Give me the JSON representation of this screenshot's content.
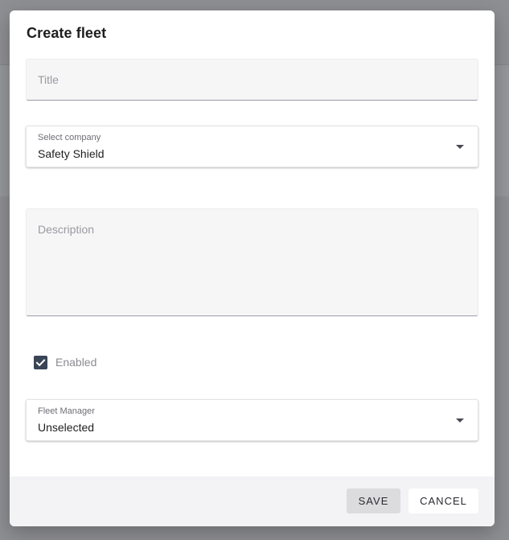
{
  "dialog": {
    "title": "Create fleet"
  },
  "form": {
    "title_field": {
      "placeholder": "Title",
      "value": ""
    },
    "company_select": {
      "label": "Select company",
      "value": "Safety Shield"
    },
    "description_field": {
      "placeholder": "Description",
      "value": ""
    },
    "enabled_checkbox": {
      "label": "Enabled",
      "checked": true
    },
    "fleet_manager_select": {
      "label": "Fleet Manager",
      "value": "Unselected"
    }
  },
  "footer": {
    "save_label": "SAVE",
    "cancel_label": "CANCEL"
  },
  "icons": {
    "select_caret": "caret-down-icon",
    "checkbox_check": "checkmark-icon"
  },
  "colors": {
    "checkbox_fill": "#3a4556",
    "backdrop": "#8e8f93"
  }
}
